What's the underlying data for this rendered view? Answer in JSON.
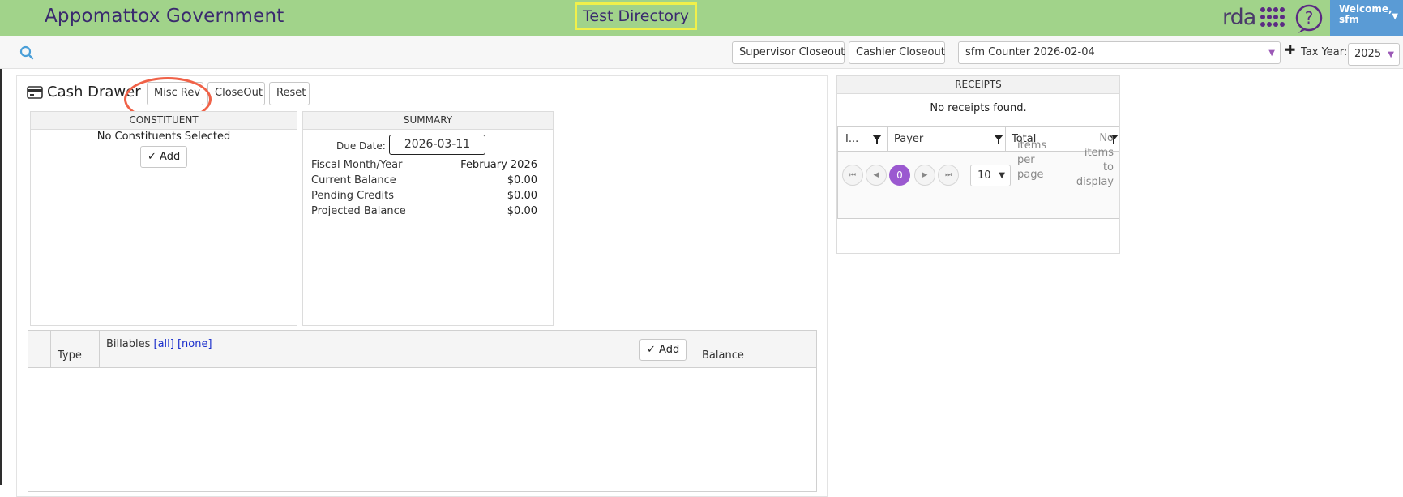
{
  "header": {
    "app_title": "Appomattox Government",
    "environment_label": "Test Directory",
    "logo_text": "rda",
    "welcome_line1": "Welcome,",
    "welcome_line2": "sfm",
    "colors": {
      "topbar": "#a1d38a",
      "welcome_bg": "#5a9bd5",
      "accent_purple": "#9b59d0",
      "highlight_border": "#f1f04a"
    }
  },
  "toolbar": {
    "search_icon": "search-icon",
    "supervisor_closeout": "Supervisor Closeout",
    "cashier_closeout": "Cashier Closeout",
    "counter_selected": "sfm Counter 2026-02-04",
    "tax_year_label": "Tax Year:",
    "tax_year_value": "2025"
  },
  "drawer": {
    "title": "Cash Drawer",
    "buttons": {
      "misc_rev": "Misc Rev",
      "closeout": "CloseOut",
      "reset": "Reset"
    }
  },
  "constituent": {
    "header": "CONSTITUENT",
    "empty_text": "No Constituents Selected",
    "add_label": "Add"
  },
  "summary": {
    "header": "SUMMARY",
    "due_date_label": "Due Date:",
    "due_date_value": "2026-03-11",
    "rows": [
      {
        "label": "Fiscal Month/Year",
        "value": "February 2026"
      },
      {
        "label": "Current Balance",
        "value": "$0.00"
      },
      {
        "label": "Pending Credits",
        "value": "$0.00"
      },
      {
        "label": "Projected Balance",
        "value": "$0.00"
      }
    ]
  },
  "billables": {
    "col_type": "Type",
    "col_billables": "Billables",
    "link_all": "[all]",
    "link_none": "[none]",
    "add_label": "Add",
    "col_balance": "Balance"
  },
  "receipts": {
    "header": "RECEIPTS",
    "empty_text": "No receipts found.",
    "columns": [
      "I...",
      "Payer",
      "Total"
    ],
    "pager": {
      "current_page": "0",
      "page_size": "10",
      "per_page_label": [
        "items",
        "per",
        "page"
      ],
      "no_items_label": [
        "No",
        "items",
        "to",
        "display"
      ]
    }
  }
}
